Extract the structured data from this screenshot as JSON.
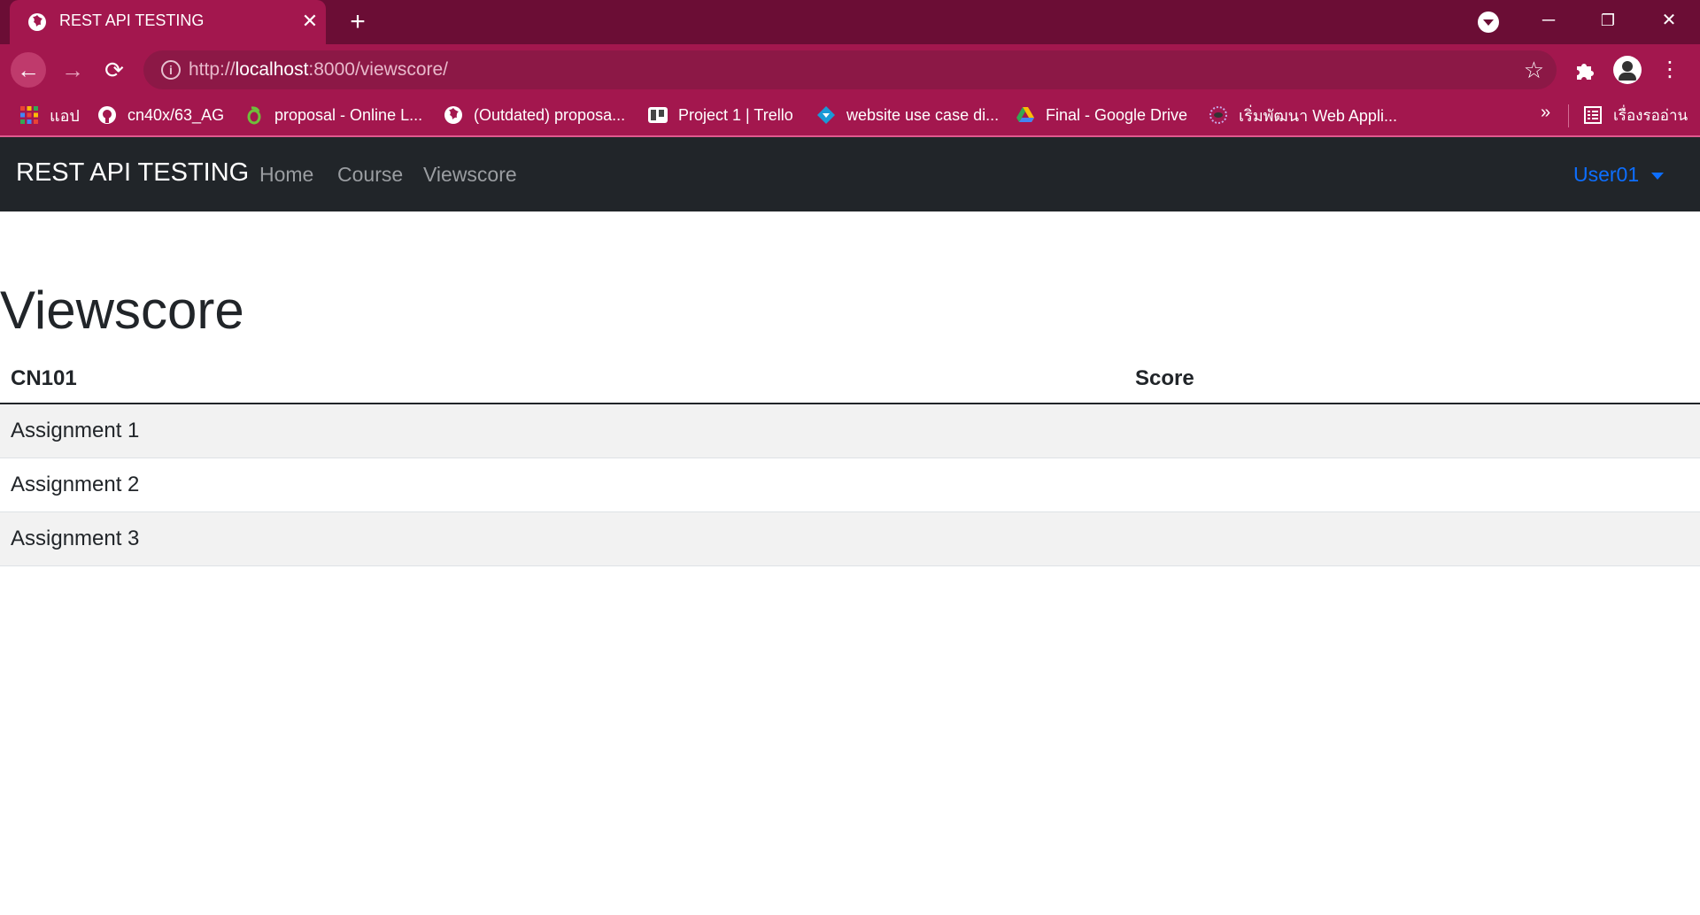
{
  "browser": {
    "tab_title": "REST API TESTING",
    "url_prefix": "http://",
    "url_host": "localhost",
    "url_path": ":8000/viewscore/",
    "bookmarks": [
      {
        "label": "แอป",
        "icon": "apps-grid-icon"
      },
      {
        "label": "cn40x/63_AG",
        "icon": "github-icon"
      },
      {
        "label": "proposal - Online L...",
        "icon": "overleaf-icon"
      },
      {
        "label": "(Outdated) proposa...",
        "icon": "globe-icon"
      },
      {
        "label": "Project 1 | Trello",
        "icon": "trello-icon"
      },
      {
        "label": "website use case di...",
        "icon": "diagram-icon"
      },
      {
        "label": "Final - Google Drive",
        "icon": "google-drive-icon"
      },
      {
        "label": "เริ่มพัฒนา Web Appli...",
        "icon": "site-logo-icon"
      }
    ],
    "reading_list": "เรื่องรออ่าน",
    "colors": {
      "tabstrip": "#6b0d35",
      "toolbar": "#a3174e",
      "omnibox": "#8c1846"
    }
  },
  "navbar": {
    "brand": "REST API TESTING",
    "links": [
      "Home",
      "Course",
      "Viewscore"
    ],
    "user": "User01",
    "colors": {
      "background": "#212529",
      "user": "#0d6efd"
    }
  },
  "main": {
    "title": "Viewscore",
    "table": {
      "headers": [
        "CN101",
        "Score"
      ],
      "rows": [
        {
          "name": "Assignment 1",
          "score": ""
        },
        {
          "name": "Assignment 2",
          "score": ""
        },
        {
          "name": "Assignment 3",
          "score": ""
        }
      ]
    }
  }
}
